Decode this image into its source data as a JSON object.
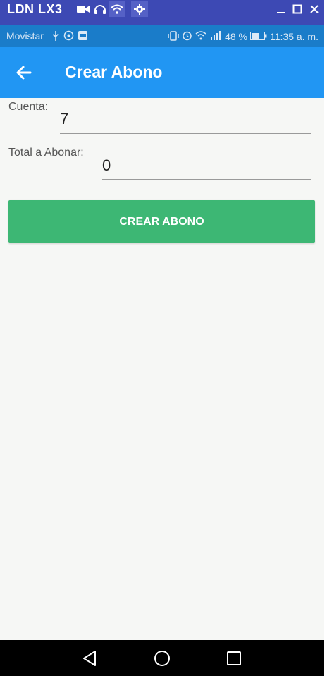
{
  "window": {
    "title": "LDN LX3",
    "icons": [
      "video-camera-icon",
      "headphones-icon",
      "wifi-icon",
      "gear-icon"
    ],
    "minimize_icon": "minimize-icon",
    "maximize_icon": "maximize-icon",
    "close_icon": "close-icon"
  },
  "status_bar": {
    "carrier": "Movistar",
    "battery": "48 %",
    "time": "11:35 a. m."
  },
  "app_bar": {
    "title": "Crear Abono",
    "back_icon": "arrow-back-icon",
    "color": "#2196f3"
  },
  "form": {
    "cuenta_label": "Cuenta:",
    "cuenta_value": "7",
    "total_label": "Total a Abonar:",
    "total_value": "0",
    "submit_label": "CREAR ABONO",
    "submit_color": "#3db774"
  },
  "nav_bar": {
    "back_icon": "nav-back-icon",
    "home_icon": "nav-home-icon",
    "recents_icon": "nav-recents-icon"
  }
}
